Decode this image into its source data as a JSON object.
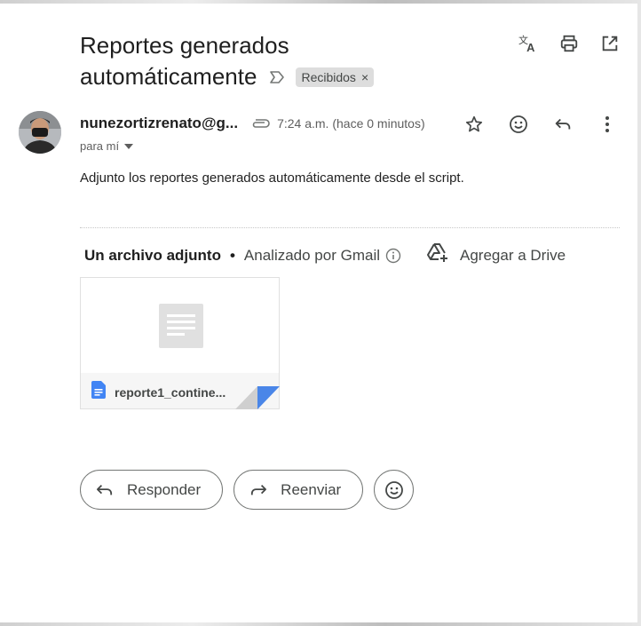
{
  "email": {
    "subject_line1": "Reportes generados",
    "subject_line2": "automáticamente",
    "label_chip": "Recibidos",
    "label_chip_close": "×",
    "sender": "nunezortizrenato@g...",
    "time": "7:24 a.m. (hace 0 minutos)",
    "recipient": "para mí",
    "body": "Adjunto los reportes generados automáticamente desde el script."
  },
  "icons": {
    "translate": "translate-icon",
    "print": "print-icon",
    "open_new_window": "open-in-new-icon",
    "important_marker": "label-arrow-icon",
    "attachment": "paperclip-icon",
    "star": "star-icon",
    "emoji": "emoji-icon",
    "reply": "reply-icon",
    "more": "more-vert-icon"
  },
  "attachments": {
    "count_label": "Un archivo adjunto",
    "separator": "•",
    "scanned_label": "Analizado por Gmail",
    "drive_label": "Agregar a Drive",
    "files": [
      {
        "name": "reporte1_contine..."
      }
    ]
  },
  "actions": {
    "reply_label": "Responder",
    "forward_label": "Reenviar"
  },
  "colors": {
    "doc_icon_blue": "#4285f4",
    "chip_bg": "#dddddd",
    "text_primary": "#1f1f1f",
    "text_secondary": "#5e5e5e"
  }
}
